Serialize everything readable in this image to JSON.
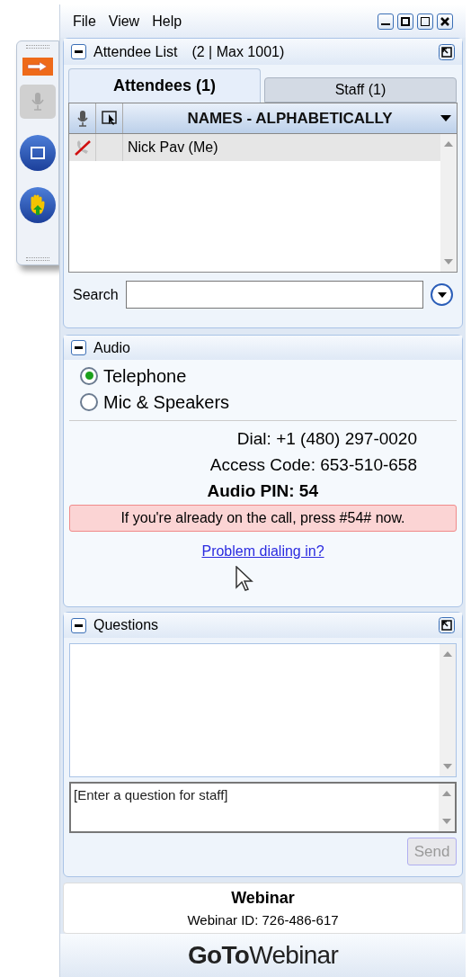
{
  "menu": [
    "File",
    "View",
    "Help"
  ],
  "attendee_panel": {
    "title": "Attendee List",
    "count": "(2 | Max 1001)",
    "tabs": [
      {
        "label": "Attendees (1)",
        "selected": true
      },
      {
        "label": "Staff (1)",
        "selected": false
      }
    ],
    "column_header": "NAMES - ALPHABETICALLY",
    "rows": [
      {
        "name": "Nick Pav (Me)",
        "selected": true
      }
    ],
    "search_label": "Search"
  },
  "audio_panel": {
    "title": "Audio",
    "options": [
      {
        "label": "Telephone",
        "selected": true
      },
      {
        "label": "Mic & Speakers",
        "selected": false
      }
    ],
    "details": [
      {
        "label": "Dial:",
        "value": "+1 (480) 297-0020",
        "bold": false
      },
      {
        "label": "Access Code:",
        "value": "653-510-658",
        "bold": false
      },
      {
        "label": "Audio PIN:",
        "value": "54",
        "bold": true
      }
    ],
    "notice": "If you're already on the call, press #54# now.",
    "link": "Problem dialing in?"
  },
  "questions_panel": {
    "title": "Questions",
    "placeholder": "[Enter a question for staff]",
    "send": {
      "label": "Send",
      "disabled": true
    }
  },
  "webinar": {
    "title": "Webinar",
    "id": "Webinar ID: 726-486-617"
  },
  "logo": "**GoTo**Webinar"
}
